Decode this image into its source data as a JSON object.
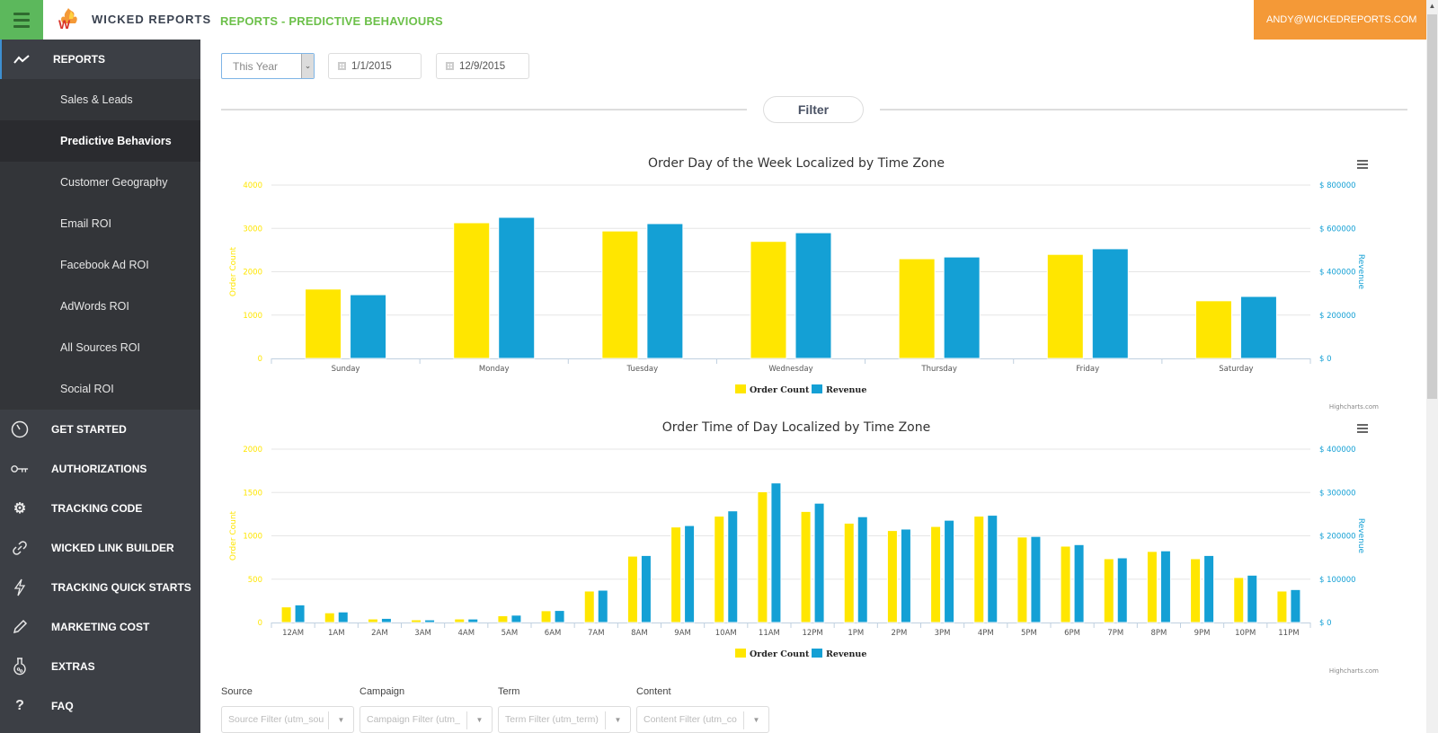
{
  "app": {
    "brand": "WICKED REPORTS",
    "page_title": "REPORTS - PREDICTIVE BEHAVIOURS",
    "user_email": "ANDY@WICKEDREPORTS.COM",
    "colors": {
      "menu_green": "#5cb85c",
      "title_green": "#6cc04a",
      "user_orange": "#f49937",
      "sidebar_bg": "#3c3f45",
      "order_yellow": "#ffe600",
      "revenue_blue": "#14a0d5"
    }
  },
  "sidebar": {
    "reports_label": "REPORTS",
    "sub_items": [
      {
        "label": "Sales & Leads",
        "active": false
      },
      {
        "label": "Predictive Behaviors",
        "active": true
      },
      {
        "label": "Customer Geography",
        "active": false
      },
      {
        "label": "Email ROI",
        "active": false
      },
      {
        "label": "Facebook Ad ROI",
        "active": false
      },
      {
        "label": "AdWords ROI",
        "active": false
      },
      {
        "label": "All Sources ROI",
        "active": false
      },
      {
        "label": "Social ROI",
        "active": false
      }
    ],
    "main_items": [
      {
        "label": "GET STARTED",
        "icon": "speedometer-icon"
      },
      {
        "label": "AUTHORIZATIONS",
        "icon": "key-icon"
      },
      {
        "label": "TRACKING CODE",
        "icon": "gear-icon"
      },
      {
        "label": "WICKED LINK BUILDER",
        "icon": "link-icon"
      },
      {
        "label": "TRACKING QUICK STARTS",
        "icon": "lightning-icon"
      },
      {
        "label": "MARKETING COST",
        "icon": "pencil-icon"
      },
      {
        "label": "EXTRAS",
        "icon": "flask-icon"
      },
      {
        "label": "FAQ",
        "icon": "question-icon"
      }
    ]
  },
  "filters": {
    "period": "This Year",
    "start_date": "1/1/2015",
    "end_date": "12/9/2015",
    "filter_button": "Filter"
  },
  "utm_filters": [
    {
      "label": "Source",
      "placeholder": "Source Filter (utm_sou"
    },
    {
      "label": "Campaign",
      "placeholder": "Campaign Filter (utm_"
    },
    {
      "label": "Term",
      "placeholder": "Term Filter (utm_term)"
    },
    {
      "label": "Content",
      "placeholder": "Content Filter (utm_co"
    }
  ],
  "credits": "Highcharts.com",
  "chart_data": [
    {
      "type": "bar",
      "title": "Order Day of the Week Localized by Time Zone",
      "categories": [
        "Sunday",
        "Monday",
        "Tuesday",
        "Wednesday",
        "Thursday",
        "Friday",
        "Saturday"
      ],
      "series": [
        {
          "name": "Order Count",
          "axis": "left",
          "color": "#ffe600",
          "values": [
            1600,
            3130,
            2940,
            2700,
            2300,
            2400,
            1330
          ]
        },
        {
          "name": "Revenue",
          "axis": "right",
          "color": "#14a0d5",
          "values": [
            294000,
            651000,
            622000,
            580000,
            468000,
            506000,
            286000
          ]
        }
      ],
      "ylabel": "Order Count",
      "ylabel_right": "Revenue",
      "ylim": [
        0,
        4000
      ],
      "ylim_right": [
        0,
        800000
      ],
      "yticks": [
        "0",
        "1000",
        "2000",
        "3000",
        "4000"
      ],
      "yticks_right": [
        "$ 0",
        "$ 200000",
        "$ 400000",
        "$ 600000",
        "$ 800000"
      ],
      "grid": true,
      "legend": "bottom-center"
    },
    {
      "type": "bar",
      "title": "Order Time of Day Localized by Time Zone",
      "categories": [
        "12AM",
        "1AM",
        "2AM",
        "3AM",
        "4AM",
        "5AM",
        "6AM",
        "7AM",
        "8AM",
        "9AM",
        "10AM",
        "11AM",
        "12PM",
        "1PM",
        "2PM",
        "3PM",
        "4PM",
        "5PM",
        "6PM",
        "7PM",
        "8PM",
        "9PM",
        "10PM",
        "11PM"
      ],
      "series": [
        {
          "name": "Order Count",
          "axis": "left",
          "color": "#ffe600",
          "values": [
            180,
            112,
            41,
            31,
            41,
            78,
            136,
            363,
            766,
            1102,
            1227,
            1508,
            1281,
            1146,
            1061,
            1108,
            1227,
            986,
            881,
            736,
            820,
            736,
            519,
            363
          ]
        },
        {
          "name": "Revenue",
          "axis": "right",
          "color": "#14a0d5",
          "values": [
            40700,
            24400,
            9500,
            6100,
            8100,
            17000,
            27800,
            74600,
            154600,
            223700,
            257600,
            322000,
            275300,
            244100,
            215600,
            236000,
            247500,
            198600,
            179700,
            149200,
            165400,
            154600,
            109200,
            76000
          ]
        }
      ],
      "ylabel": "Order Count",
      "ylabel_right": "Revenue",
      "ylim": [
        0,
        2000
      ],
      "ylim_right": [
        0,
        400000
      ],
      "yticks": [
        "0",
        "500",
        "1000",
        "1500",
        "2000"
      ],
      "yticks_right": [
        "$ 0",
        "$ 100000",
        "$ 200000",
        "$ 300000",
        "$ 400000"
      ],
      "grid": true,
      "legend": "bottom-center"
    }
  ]
}
